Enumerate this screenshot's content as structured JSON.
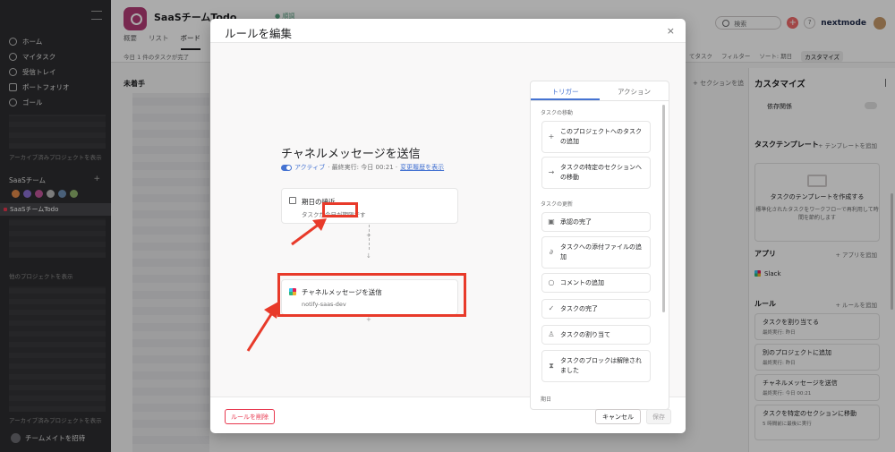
{
  "sidebar": {
    "nav": [
      {
        "label": "ホーム",
        "icon": "home-icon"
      },
      {
        "label": "マイタスク",
        "icon": "check-circle-icon"
      },
      {
        "label": "受信トレイ",
        "icon": "bell-icon"
      },
      {
        "label": "ポートフォリオ",
        "icon": "chart-icon"
      },
      {
        "label": "ゴール",
        "icon": "person-icon"
      }
    ],
    "archived_note_1": "アーカイブ済みプロジェクトを表示",
    "team_name": "SaaSチーム",
    "active_project": "SaaSチームTodo",
    "other_projects": "他のプロジェクトを表示",
    "archived_note_2": "アーカイブ済みプロジェクトを表示",
    "invite": "チームメイトを招待"
  },
  "project": {
    "title": "SaaSチームTodo",
    "status": "● 順調",
    "tabs": [
      "概要",
      "リスト",
      "ボード"
    ],
    "note": "今日 1 件のタスクが完了",
    "search_placeholder": "検索",
    "brand": "nextmode",
    "toolbar": [
      "てタスク",
      "フィルター",
      "ソート: 期日",
      "カスタマイズ"
    ],
    "column_title": "未着手",
    "add_section": "+ セクションを追"
  },
  "customize": {
    "title": "カスタマイズ",
    "dependency": "依存関係",
    "template_section": "タスクテンプレート",
    "template_add": "+ テンプレートを追加",
    "template_box_title": "タスクのテンプレートを作成する",
    "template_box_desc": "標準化されたタスクをワークフローで再利用して時間を節約します",
    "apps_section": "アプリ",
    "apps_add": "+ アプリを追加",
    "app_slack": "Slack",
    "rules_section": "ルール",
    "rules_add": "+ ルールを追加",
    "rules": [
      {
        "name": "タスクを割り当てる",
        "meta": "最終実行: 昨日"
      },
      {
        "name": "別のプロジェクトに追加",
        "meta": "最終実行: 昨日"
      },
      {
        "name": "チャネルメッセージを送信",
        "meta": "最終実行: 今日 00:21"
      },
      {
        "name": "タスクを特定のセクションに移動",
        "meta": "5 時間前に最後に実行"
      }
    ]
  },
  "modal": {
    "title": "ルールを編集",
    "close": "×",
    "rule_heading": "チャネルメッセージを送信",
    "active": "アクティブ",
    "last_run": "· 最終実行: 今日 00:21 ·",
    "history_link": "変更履歴を表示",
    "trigger": {
      "title": "期日の接近",
      "subtitle": "タスクが今日が期限です"
    },
    "action": {
      "title": "チャネルメッセージを送信",
      "subtitle": "notify-saas-dev"
    },
    "plus": "+",
    "delete": "ルールを削除",
    "cancel": "キャンセル",
    "save": "保存"
  },
  "picker": {
    "tabs": [
      "トリガー",
      "アクション"
    ],
    "section_move": "タスクの移動",
    "move_items": [
      {
        "label": "このプロジェクトへのタスクの追加",
        "icon": "plus-icon"
      },
      {
        "label": "タスクの特定のセクションへの移動",
        "icon": "arrow-right-icon"
      }
    ],
    "section_change": "タスクの更新",
    "change_items": [
      {
        "label": "承認の完了",
        "icon": "approval-icon"
      },
      {
        "label": "タスクへの添付ファイルの追加",
        "icon": "paperclip-icon"
      },
      {
        "label": "コメントの追加",
        "icon": "comment-icon"
      },
      {
        "label": "タスクの完了",
        "icon": "check-circle-icon"
      },
      {
        "label": "タスクの割り当て",
        "icon": "person-icon"
      },
      {
        "label": "タスクのブロックは解除されました",
        "icon": "hourglass-icon"
      }
    ],
    "section_due": "期日"
  },
  "colors": {
    "sidebar_bg": "#2e2e30",
    "accent_blue": "#4573d2",
    "annotation_red": "#e83a2a",
    "delete_red": "#e8384f",
    "project_icon": "#b33c76"
  }
}
